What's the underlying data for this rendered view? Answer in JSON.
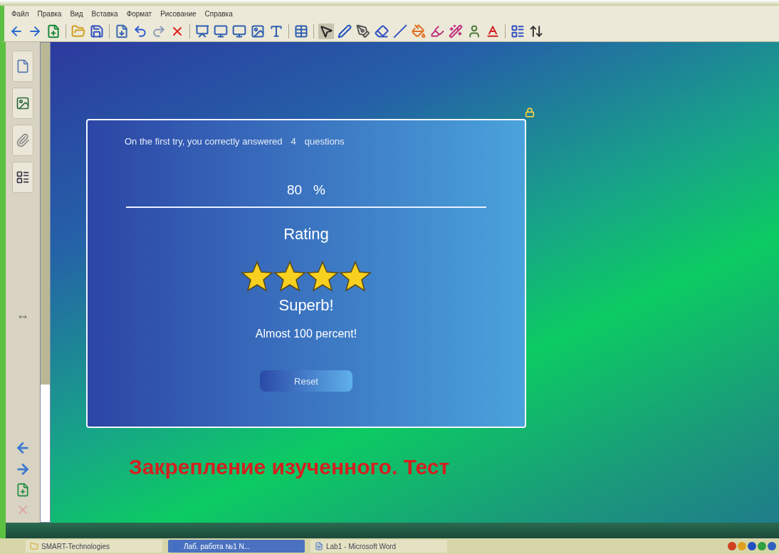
{
  "menu": [
    "Файл",
    "Правка",
    "Вид",
    "Вставка",
    "Формат",
    "Рисование",
    "Справка"
  ],
  "quiz": {
    "summary": "On the first try, you correctly answered",
    "count": "4",
    "count_unit": "questions",
    "score": "80",
    "score_unit": "%",
    "rating_label": "Rating",
    "stars": 4,
    "verdict": "Superb!",
    "comment": "Almost 100 percent!",
    "reset": "Reset"
  },
  "slide_title": "Закрепление изученного. Тест",
  "taskbar": [
    {
      "label": "SMART-Technologies",
      "kind": "folder",
      "selected": false
    },
    {
      "label": "Лаб. работа №1 N...",
      "kind": "doc",
      "selected": true
    },
    {
      "label": "Lab1 - Microsoft Word",
      "kind": "doc",
      "selected": false
    }
  ]
}
